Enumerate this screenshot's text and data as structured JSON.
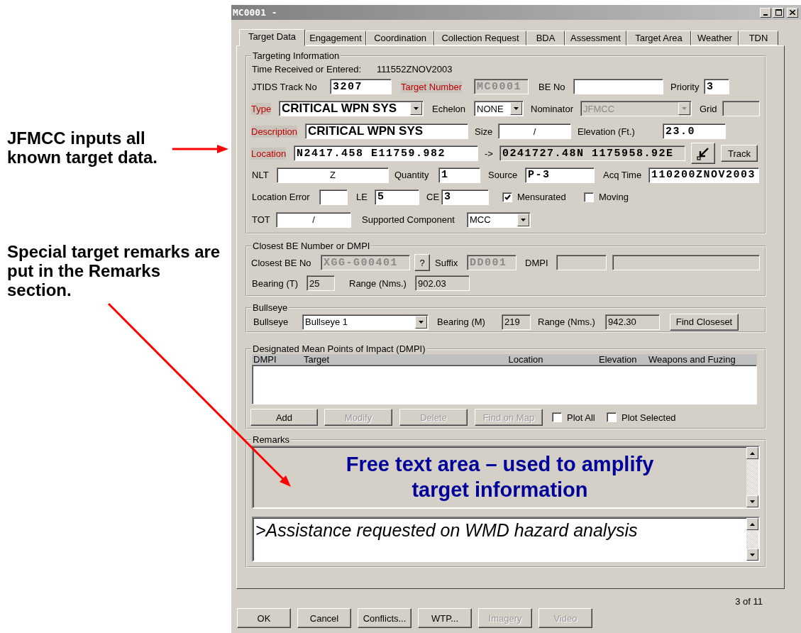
{
  "annotations": [
    {
      "text": "JFMCC inputs all known target data."
    },
    {
      "text": "Special target remarks are put in the Remarks section."
    }
  ],
  "window": {
    "title": "MC0001 -"
  },
  "tabs": [
    {
      "label": "Target Data",
      "selected": true
    },
    {
      "label": "Engagement",
      "selected": false
    },
    {
      "label": "Coordination",
      "selected": false
    },
    {
      "label": "Collection Request",
      "selected": false
    },
    {
      "label": "BDA",
      "selected": false
    },
    {
      "label": "Assessment",
      "selected": false
    },
    {
      "label": "Target Area",
      "selected": false
    },
    {
      "label": "Weather",
      "selected": false
    },
    {
      "label": "TDN",
      "selected": false
    }
  ],
  "targeting_information": {
    "title": "Targeting Information",
    "rows": [
      {
        "items": [
          {
            "kind": "label",
            "text": "Time Received or Entered:"
          },
          {
            "kind": "value",
            "text": "111552ZNOV2003"
          }
        ]
      },
      {
        "items": [
          {
            "kind": "label",
            "text": "JTIDS Track No"
          },
          {
            "kind": "code-field",
            "value": "3207"
          },
          {
            "kind": "label",
            "text": "Target Number",
            "required": true
          },
          {
            "kind": "code-field",
            "value": "MC0001",
            "disabled": true
          },
          {
            "kind": "label",
            "text": "BE No"
          },
          {
            "kind": "field"
          },
          {
            "kind": "label",
            "text": "Priority"
          },
          {
            "kind": "code-field",
            "value": "3"
          }
        ]
      },
      {
        "items": [
          {
            "kind": "label",
            "text": "Type",
            "required": true
          },
          {
            "kind": "large-combo",
            "value": "CRITICAL WPN SYS"
          },
          {
            "kind": "label",
            "text": "Echelon"
          },
          {
            "kind": "combo",
            "value": "NONE"
          },
          {
            "kind": "label",
            "text": "Nominator"
          },
          {
            "kind": "combo",
            "value": "JFMCC",
            "disabled": true
          },
          {
            "kind": "label",
            "text": "Grid"
          },
          {
            "kind": "field",
            "disabled": true
          }
        ]
      },
      {
        "items": [
          {
            "kind": "label",
            "text": "Description",
            "required": true
          },
          {
            "kind": "large-field",
            "value": "CRITICAL WPN SYS"
          },
          {
            "kind": "label",
            "text": "Size"
          },
          {
            "kind": "field",
            "value": "/"
          },
          {
            "kind": "label",
            "text": "Elevation (Ft.)"
          },
          {
            "kind": "code-field",
            "value": "23.0"
          }
        ]
      },
      {
        "items": [
          {
            "kind": "label",
            "text": "Location",
            "required": true
          },
          {
            "kind": "code-field",
            "value": "N2417.458 E11759.982"
          },
          {
            "kind": "label",
            "text": "->"
          },
          {
            "kind": "code-field",
            "value": "0241727.48N 1175958.92E",
            "readonly": true
          },
          {
            "kind": "icon-button"
          },
          {
            "kind": "button",
            "label": "Track"
          }
        ]
      },
      {
        "items": [
          {
            "kind": "label",
            "text": "NLT"
          },
          {
            "kind": "field",
            "value": "Z"
          },
          {
            "kind": "label",
            "text": "Quantity"
          },
          {
            "kind": "code-field",
            "value": "1"
          },
          {
            "kind": "label",
            "text": "Source"
          },
          {
            "kind": "code-field",
            "value": "P-3"
          },
          {
            "kind": "label",
            "text": "Acq Time"
          },
          {
            "kind": "code-field",
            "value": "110200ZNOV2003"
          }
        ]
      },
      {
        "items": [
          {
            "kind": "label",
            "text": "Location Error"
          },
          {
            "kind": "field"
          },
          {
            "kind": "label",
            "text": "LE"
          },
          {
            "kind": "code-field",
            "value": "5"
          },
          {
            "kind": "label",
            "text": "CE"
          },
          {
            "kind": "code-field",
            "value": "3"
          },
          {
            "kind": "checkbox",
            "label": "Mensurated",
            "checked": true
          },
          {
            "kind": "checkbox",
            "label": "Moving",
            "checked": false
          }
        ]
      },
      {
        "items": [
          {
            "kind": "label",
            "text": "TOT"
          },
          {
            "kind": "field",
            "value": "/"
          },
          {
            "kind": "label",
            "text": "Supported Component"
          },
          {
            "kind": "combo",
            "value": "MCC"
          }
        ]
      }
    ]
  },
  "closest_be": {
    "title": "Closest BE Number or DMPI",
    "rows": [
      {
        "items": [
          {
            "kind": "label",
            "text": "Closest BE No"
          },
          {
            "kind": "code-field",
            "value": "XGG-G00401",
            "disabled": true
          },
          {
            "kind": "button",
            "label": "?"
          },
          {
            "kind": "label",
            "text": "Suffix"
          },
          {
            "kind": "code-field",
            "value": "DD001",
            "disabled": true
          },
          {
            "kind": "label",
            "text": "DMPI"
          },
          {
            "kind": "field",
            "disabled": true
          },
          {
            "kind": "field",
            "disabled": true
          }
        ]
      },
      {
        "items": [
          {
            "kind": "label",
            "text": "Bearing (T)"
          },
          {
            "kind": "field",
            "value": "25",
            "readonly": true
          },
          {
            "kind": "label",
            "text": "Range (Nms.)"
          },
          {
            "kind": "field",
            "value": "902.03",
            "readonly": true
          }
        ]
      }
    ]
  },
  "bullseye": {
    "title": "Bullseye",
    "rows": [
      {
        "items": [
          {
            "kind": "label",
            "text": "Bullseye"
          },
          {
            "kind": "combo",
            "value": "Bullseye 1"
          },
          {
            "kind": "label",
            "text": "Bearing (M)"
          },
          {
            "kind": "field",
            "value": "219",
            "readonly": true
          },
          {
            "kind": "label",
            "text": "Range (Nms.)"
          },
          {
            "kind": "field",
            "value": "942.30",
            "readonly": true
          },
          {
            "kind": "button",
            "label": "Find Closeset"
          }
        ]
      }
    ]
  },
  "dmpi": {
    "title": "Designated Mean Points of Impact (DMPI)",
    "columns": [
      "DMPI",
      "Target",
      "Location",
      "Elevation",
      "Weapons and Fuzing"
    ],
    "controls": [
      {
        "kind": "button",
        "label": "Add"
      },
      {
        "kind": "button",
        "label": "Modify",
        "disabled": true
      },
      {
        "kind": "button",
        "label": "Delete",
        "disabled": true
      },
      {
        "kind": "button",
        "label": "Find on Map",
        "disabled": true
      },
      {
        "kind": "checkbox",
        "label": "Plot All",
        "checked": false
      },
      {
        "kind": "checkbox",
        "label": "Plot Selected",
        "checked": false
      }
    ]
  },
  "remarks": {
    "title": "Remarks",
    "free_text": "Free text area – used to amplify target information",
    "entry": ">Assistance requested on WMD hazard analysis"
  },
  "record_position": "3 of 11",
  "buttons": [
    {
      "label": "OK",
      "disabled": false
    },
    {
      "label": "Cancel",
      "disabled": false
    },
    {
      "label": "Conflicts...",
      "disabled": false
    },
    {
      "label": "WTP...",
      "disabled": false
    },
    {
      "label": "Imagery",
      "disabled": true
    },
    {
      "label": "Video",
      "disabled": true
    }
  ]
}
